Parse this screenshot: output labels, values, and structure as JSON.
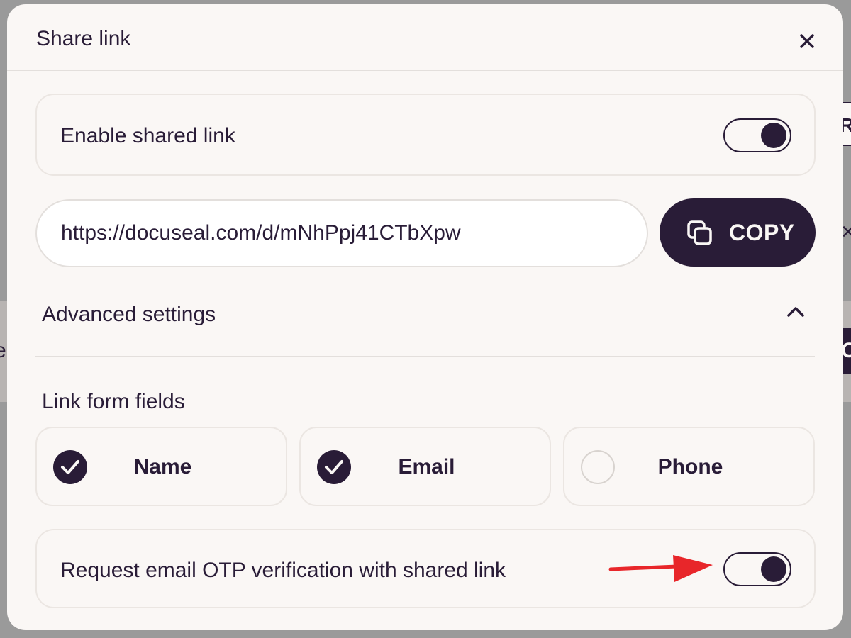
{
  "background": {
    "right_box_text": "R",
    "right_x_text": "×",
    "right_dark_text": "C",
    "left_text": "ea"
  },
  "modal": {
    "title": "Share link",
    "close_icon": "close-icon"
  },
  "enable_shared_link": {
    "label": "Enable shared link",
    "enabled": true
  },
  "share_url": {
    "value": "https://docuseal.com/d/mNhPpj41CTbXpw",
    "copy_label": "COPY",
    "copy_icon": "copy-icon"
  },
  "advanced_settings": {
    "label": "Advanced settings",
    "expanded": true,
    "icon": "chevron-up-icon"
  },
  "link_form_fields": {
    "label": "Link form fields",
    "fields": [
      {
        "label": "Name",
        "checked": true
      },
      {
        "label": "Email",
        "checked": true
      },
      {
        "label": "Phone",
        "checked": false
      }
    ]
  },
  "otp_verification": {
    "label": "Request email OTP verification with shared link",
    "enabled": true
  },
  "annotation": {
    "arrow_icon": "red-arrow-icon",
    "color": "#e8262a"
  },
  "colors": {
    "primary": "#291c37",
    "surface": "#faf7f5",
    "border": "#ebe6e2"
  }
}
